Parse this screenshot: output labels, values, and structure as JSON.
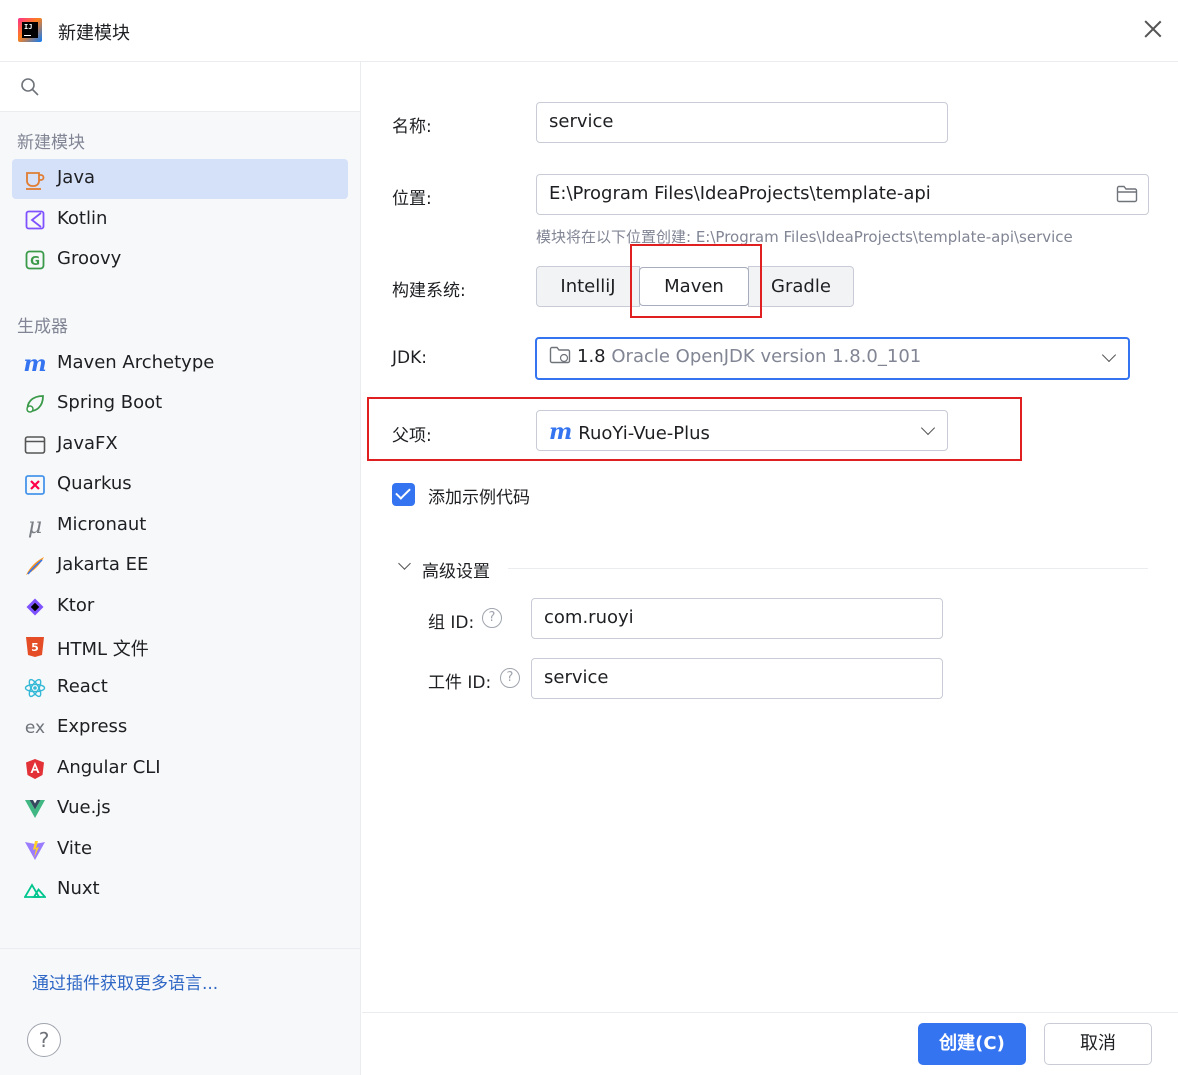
{
  "window": {
    "title": "新建模块"
  },
  "sidebar": {
    "section_new": "新建模块",
    "section_generators": "生成器",
    "languages": [
      {
        "label": "Java",
        "icon": "java-cup-icon",
        "selected": true
      },
      {
        "label": "Kotlin",
        "icon": "kotlin-icon"
      },
      {
        "label": "Groovy",
        "icon": "groovy-icon"
      }
    ],
    "generators": [
      {
        "label": "Maven Archetype",
        "icon": "maven-icon"
      },
      {
        "label": "Spring Boot",
        "icon": "spring-boot-icon"
      },
      {
        "label": "JavaFX",
        "icon": "javafx-window-icon"
      },
      {
        "label": "Quarkus",
        "icon": "quarkus-icon"
      },
      {
        "label": "Micronaut",
        "icon": "micronaut-icon"
      },
      {
        "label": "Jakarta EE",
        "icon": "jakarta-ee-icon"
      },
      {
        "label": "Ktor",
        "icon": "ktor-icon"
      },
      {
        "label": "HTML 文件",
        "icon": "html5-icon"
      },
      {
        "label": "React",
        "icon": "react-icon"
      },
      {
        "label": "Express",
        "icon": "express-icon"
      },
      {
        "label": "Angular CLI",
        "icon": "angular-icon"
      },
      {
        "label": "Vue.js",
        "icon": "vue-icon"
      },
      {
        "label": "Vite",
        "icon": "vite-icon"
      },
      {
        "label": "Nuxt",
        "icon": "nuxt-icon"
      }
    ],
    "plugins_link": "通过插件获取更多语言..."
  },
  "form": {
    "name_label": "名称:",
    "name_value": "service",
    "location_label": "位置:",
    "location_value": "E:\\Program Files\\IdeaProjects\\template-api",
    "location_hint": "模块将在以下位置创建: E:\\Program Files\\IdeaProjects\\template-api\\service",
    "build_label": "构建系统:",
    "build_options": [
      "IntelliJ",
      "Maven",
      "Gradle"
    ],
    "build_selected": "Maven",
    "jdk_label": "JDK:",
    "jdk_version": "1.8",
    "jdk_name": "Oracle OpenJDK version 1.8.0_101",
    "parent_label": "父项:",
    "parent_value": "RuoYi-Vue-Plus",
    "sample_code_label": "添加示例代码",
    "sample_code_checked": true,
    "advanced_label": "高级设置",
    "group_id_label": "组 ID:",
    "group_id_value": "com.ruoyi",
    "artifact_id_label": "工件 ID:",
    "artifact_id_value": "service"
  },
  "footer": {
    "help": "?",
    "create_label": "创建(C)",
    "cancel_label": "取消"
  },
  "colors": {
    "accent": "#3574f0",
    "selection": "#d5e1f9",
    "highlight_box": "#e02020"
  }
}
